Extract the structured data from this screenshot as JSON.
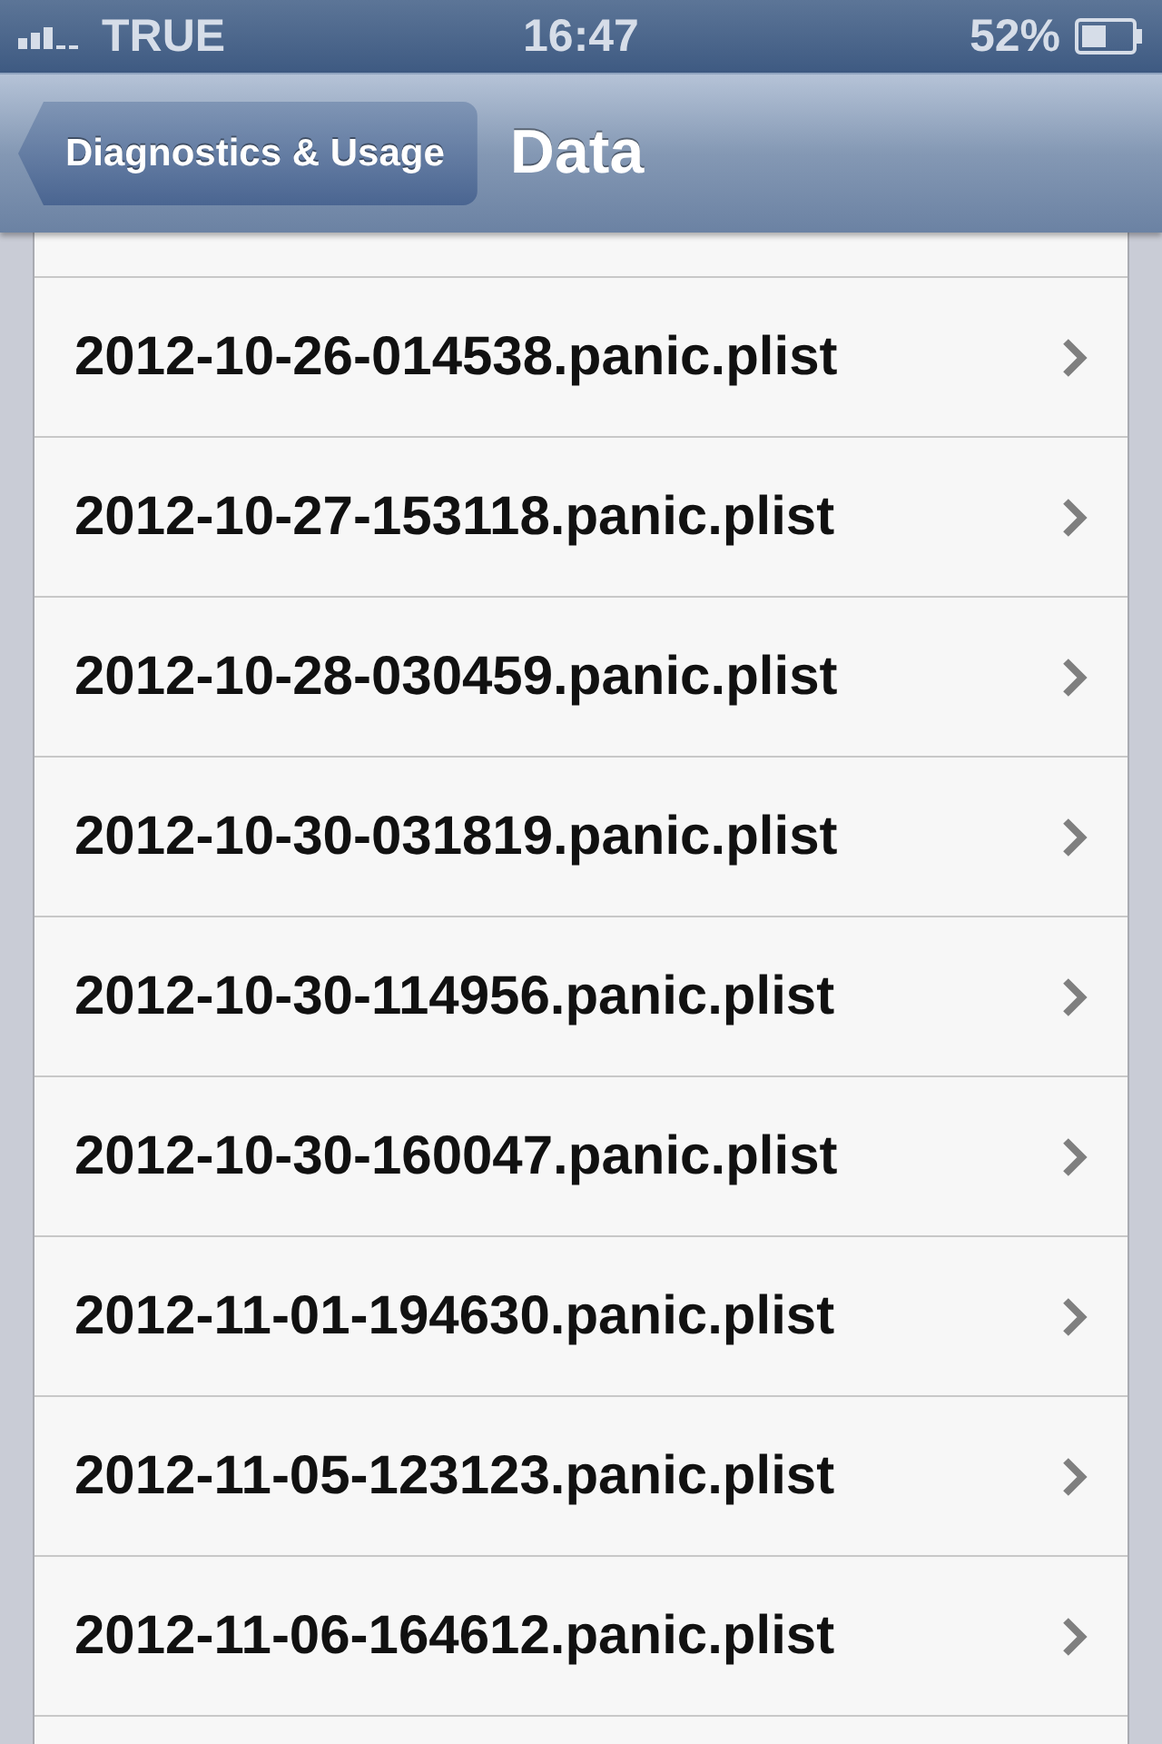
{
  "status_bar": {
    "carrier": "TRUE",
    "time": "16:47",
    "battery": "52%"
  },
  "nav_bar": {
    "back": "Diagnostics & Usage",
    "title": "Data"
  },
  "files": [
    {
      "name": "2012-10-26-014538.panic.plist"
    },
    {
      "name": "2012-10-27-153118.panic.plist"
    },
    {
      "name": "2012-10-28-030459.panic.plist"
    },
    {
      "name": "2012-10-30-031819.panic.plist"
    },
    {
      "name": "2012-10-30-114956.panic.plist"
    },
    {
      "name": "2012-10-30-160047.panic.plist"
    },
    {
      "name": "2012-11-01-194630.panic.plist"
    },
    {
      "name": "2012-11-05-123123.panic.plist"
    },
    {
      "name": "2012-11-06-164612.panic.plist"
    }
  ]
}
